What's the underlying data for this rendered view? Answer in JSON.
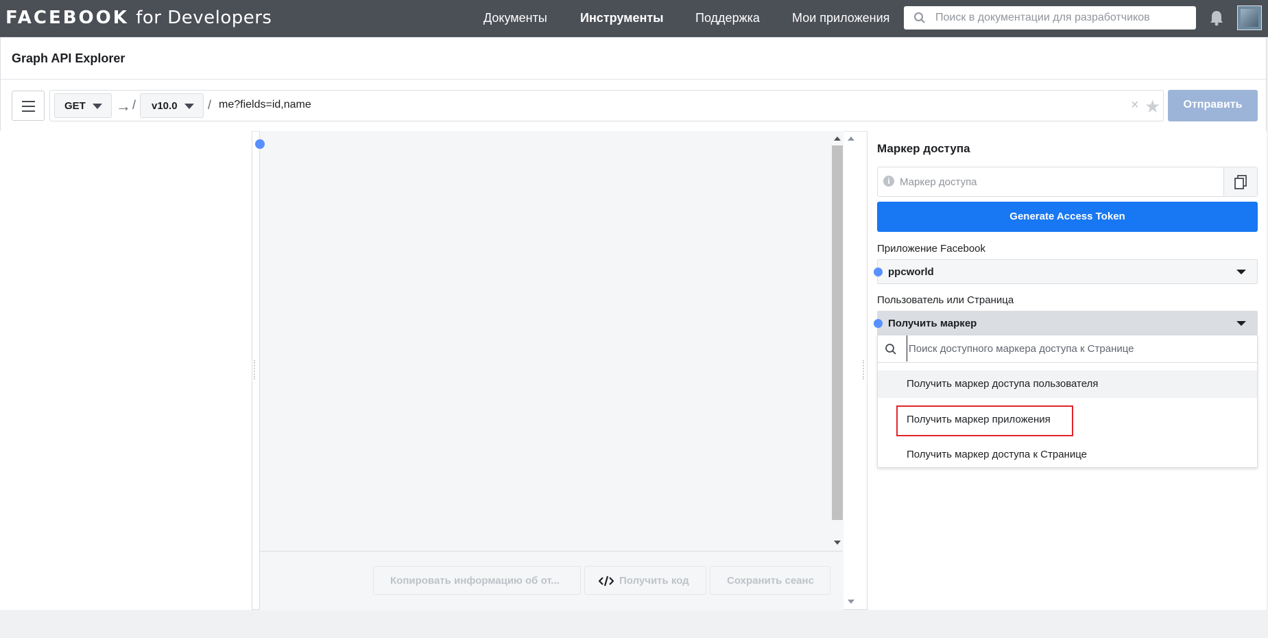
{
  "header": {
    "logo_brand": "FACEBOOK",
    "logo_suffix": "for Developers",
    "nav": [
      "Документы",
      "Инструменты",
      "Поддержка",
      "Мои приложения"
    ],
    "search_placeholder": "Поиск в документации для разработчиков"
  },
  "page": {
    "title": "Graph API Explorer"
  },
  "query": {
    "method": "GET",
    "version": "v10.0",
    "path": "me?fields=id,name",
    "arrow": "→",
    "slash": "/",
    "clear": "×",
    "star": "★",
    "submit_label": "Отправить"
  },
  "center": {
    "actions": [
      "Копировать информацию об от...",
      "Получить код",
      "Сохранить сеанс"
    ]
  },
  "access": {
    "title": "Маркер доступа",
    "token_placeholder": "Маркер доступа",
    "info_glyph": "i",
    "generate_label": "Generate Access Token",
    "app_label": "Приложение Facebook",
    "app_value": "ppcworld",
    "user_label": "Пользователь или Страница",
    "user_value": "Получить маркер",
    "dropdown_search_placeholder": "Поиск доступного маркера доступа к Странице",
    "dropdown_items": [
      "Получить маркер доступа пользователя",
      "Получить маркер приложения",
      "Получить маркер доступа к Странице"
    ]
  },
  "colors": {
    "topbar": "#4b4f56",
    "primary": "#1877f2",
    "send_disabled": "#9cb4d8",
    "highlight": "#e0252c",
    "dot": "#5890ff"
  }
}
